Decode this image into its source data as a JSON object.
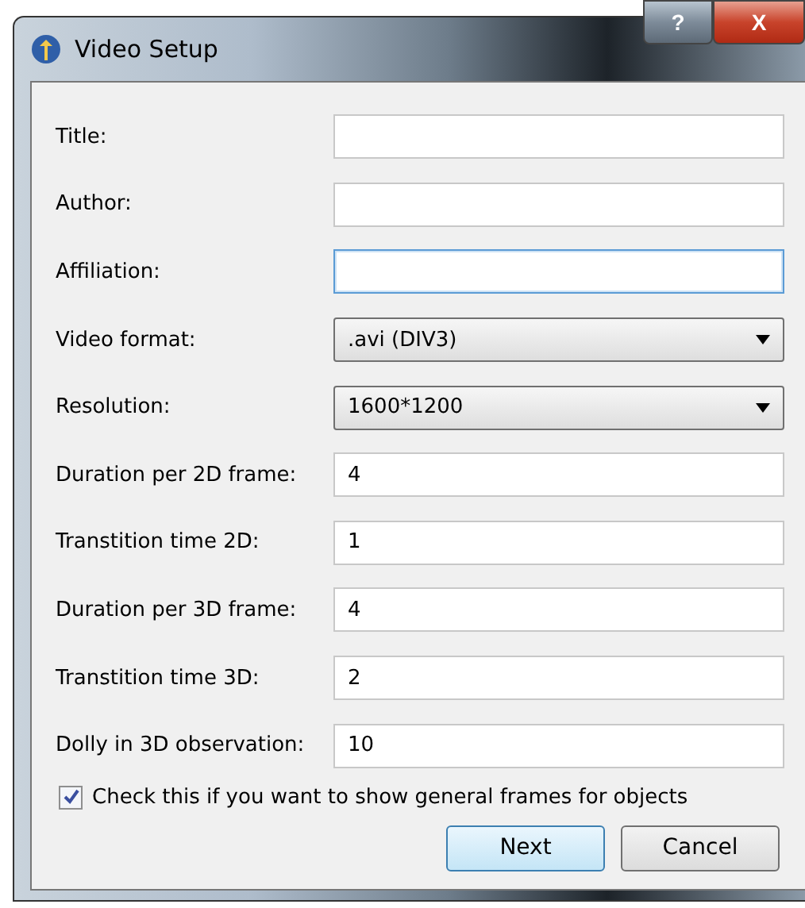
{
  "window": {
    "title": "Video Setup",
    "buttons": [
      {
        "kind": "help",
        "label": "?"
      },
      {
        "kind": "close",
        "label": "X"
      }
    ]
  },
  "fields": [
    {
      "label": "Title:",
      "kind": "text",
      "focused": false
    },
    {
      "label": "Author:",
      "kind": "text",
      "focused": false
    },
    {
      "label": "Affiliation:",
      "kind": "text",
      "focused": true
    },
    {
      "label": "Video format:",
      "kind": "select",
      "value": ".avi (DIV3)"
    },
    {
      "label": "Resolution:",
      "kind": "select",
      "value": "1600*1200"
    },
    {
      "label": "Duration per 2D frame:",
      "kind": "text",
      "value": "4",
      "focused": false
    },
    {
      "label": "Transtition time 2D:",
      "kind": "text",
      "value": "1",
      "focused": false
    },
    {
      "label": "Duration per 3D frame:",
      "kind": "text",
      "value": "4",
      "focused": false
    },
    {
      "label": "Transtition time 3D:",
      "kind": "text",
      "value": "2",
      "focused": false
    },
    {
      "label": "Dolly in 3D observation:",
      "kind": "text",
      "value": "10",
      "focused": false
    }
  ],
  "checkbox": {
    "label": "Check this if you want to show general frames for objects",
    "checked": true
  },
  "buttons": [
    {
      "label": "Next",
      "default": true
    },
    {
      "label": "Cancel",
      "default": false
    }
  ]
}
